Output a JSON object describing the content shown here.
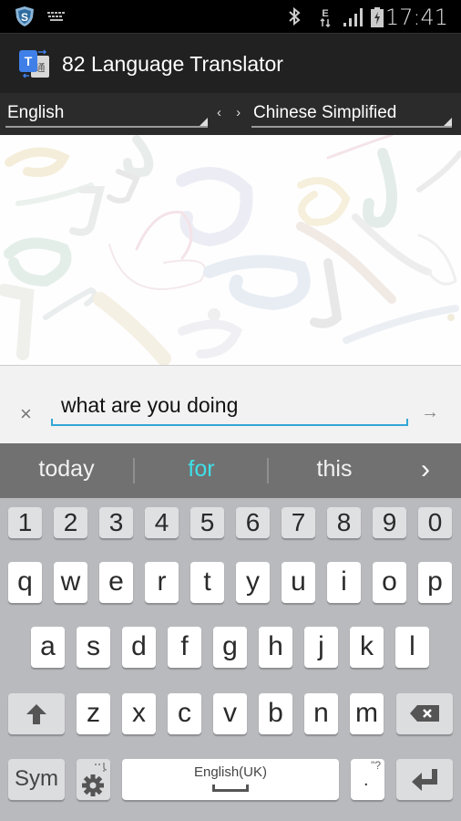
{
  "status_bar": {
    "time": "17:41",
    "left_icons": [
      "shield-app-icon",
      "keyboard-icon"
    ],
    "right_icons": [
      "bluetooth-icon",
      "data-e-icon",
      "signal-icon",
      "battery-charging-icon"
    ]
  },
  "app": {
    "title": "82 Language Translator",
    "logo": "translator-logo-icon"
  },
  "language_bar": {
    "source_language": "English",
    "target_language": "Chinese Simplified",
    "swap_label": "‹ ›"
  },
  "input": {
    "clear_label": "×",
    "value": "what are you doing",
    "go_label": "→"
  },
  "suggestions": {
    "items": [
      {
        "label": "today",
        "highlighted": false
      },
      {
        "label": "for",
        "highlighted": true
      },
      {
        "label": "this",
        "highlighted": false
      }
    ],
    "more_label": "›",
    "highlight_color": "#3ee0e6"
  },
  "keyboard": {
    "number_row": [
      "1",
      "2",
      "3",
      "4",
      "5",
      "6",
      "7",
      "8",
      "9",
      "0"
    ],
    "row1": [
      "q",
      "w",
      "e",
      "r",
      "t",
      "y",
      "u",
      "i",
      "o",
      "p"
    ],
    "row2": [
      "a",
      "s",
      "d",
      "f",
      "g",
      "h",
      "j",
      "k",
      "l"
    ],
    "row3": [
      "z",
      "x",
      "c",
      "v",
      "b",
      "n",
      "m"
    ],
    "sym_label": "Sym",
    "space_label": "English(UK)",
    "period_label": ".",
    "period_hint": "\"?",
    "shift_icon": "shift-arrow-icon",
    "backspace_icon": "backspace-icon",
    "settings_icon": "gear-icon",
    "enter_icon": "enter-icon"
  }
}
